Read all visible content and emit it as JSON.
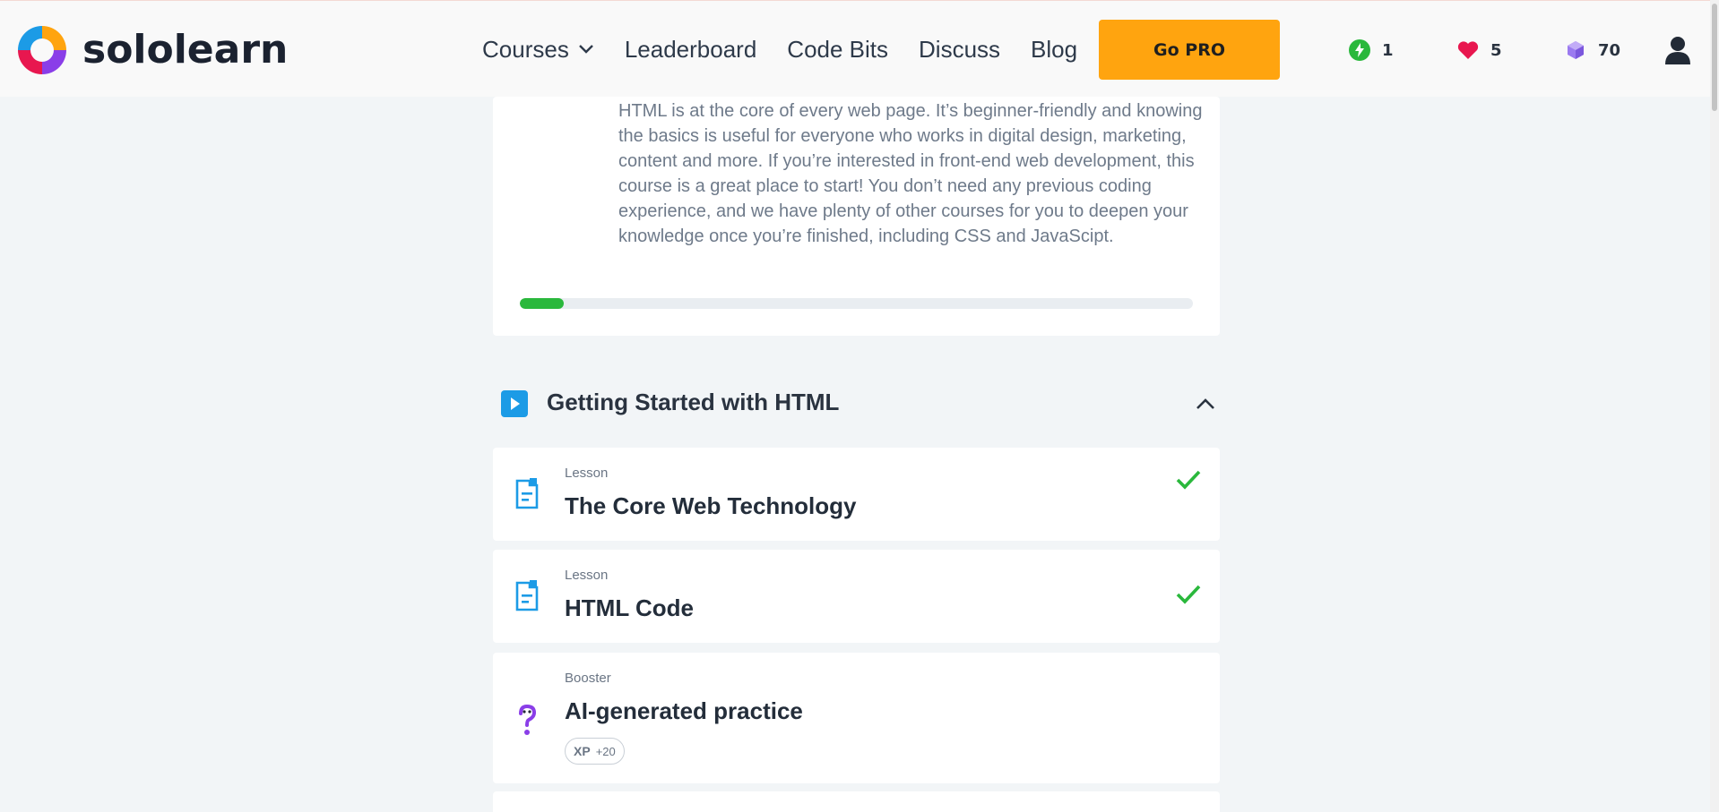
{
  "brand": {
    "name": "sololearn"
  },
  "nav": {
    "courses": "Courses",
    "leaderboard": "Leaderboard",
    "code_bits": "Code Bits",
    "discuss": "Discuss",
    "blog": "Blog"
  },
  "header": {
    "go_pro": "Go PRO",
    "streak": "1",
    "hearts": "5",
    "gems": "70"
  },
  "intro": {
    "description": "HTML is at the core of every web page. It’s beginner-friendly and knowing the basics is useful for everyone who works in digital design, marketing, content and more. If you’re interested in front-end web development, this course is a great place to start! You don’t need any previous coding experience, and we have plenty of other courses for you to deepen your knowledge once you’re finished, including CSS and JavaScipt.",
    "progress_percent": 6.5
  },
  "module": {
    "title": "Getting Started with HTML"
  },
  "lessons": [
    {
      "kind": "Lesson",
      "title": "The Core Web Technology",
      "completed": true
    },
    {
      "kind": "Lesson",
      "title": "HTML Code",
      "completed": true
    },
    {
      "kind": "Booster",
      "title": "AI-generated practice",
      "completed": false,
      "xp_label": "XP",
      "xp_value": "+20"
    }
  ],
  "colors": {
    "accent_orange": "#ffa40f",
    "success_green": "#2ab83c",
    "lesson_blue": "#1c9be6",
    "booster_purple": "#8a3ee8",
    "heart_pink": "#e8174f",
    "gem_purple": "#9b7af0"
  },
  "icons": {
    "logo": "sololearn-logo-icon",
    "streak": "lightning-icon",
    "hearts": "heart-icon",
    "gems": "gem-icon",
    "user": "user-icon",
    "module": "play-icon",
    "collapse": "chevron-up-icon",
    "lesson": "document-icon",
    "booster": "question-icon",
    "check": "check-icon"
  }
}
